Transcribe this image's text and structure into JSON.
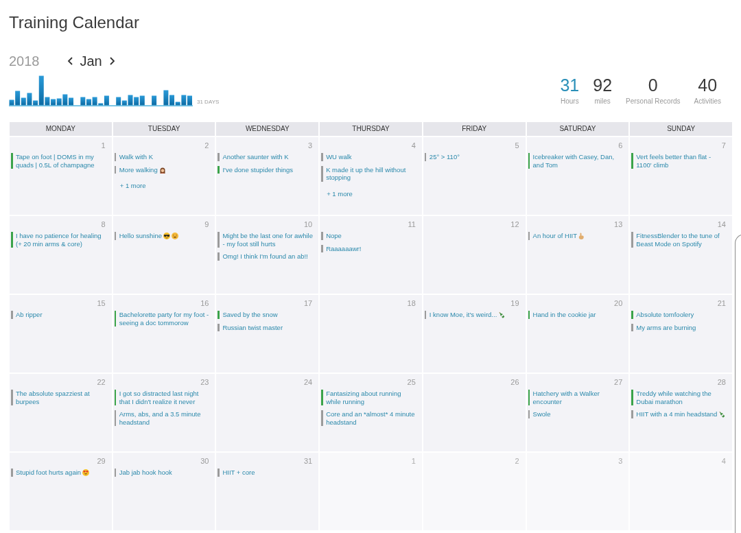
{
  "title": "Training Calendar",
  "nav": {
    "year": "2018",
    "month": "Jan"
  },
  "sparkline": {
    "label": "31 DAYS"
  },
  "stats": [
    {
      "value": "31",
      "label": "Hours",
      "selected": true
    },
    {
      "value": "92",
      "label": "miles",
      "selected": false
    },
    {
      "value": "0",
      "label": "Personal Records",
      "selected": false
    },
    {
      "value": "40",
      "label": "Activities",
      "selected": false
    }
  ],
  "calendar": {
    "weekdays": [
      "MONDAY",
      "TUESDAY",
      "WEDNESDAY",
      "THURSDAY",
      "FRIDAY",
      "SATURDAY",
      "SUNDAY"
    ],
    "weeks": [
      {
        "days": [
          {
            "day": "1",
            "other_month": false,
            "events": [
              {
                "text": "Tape on foot | DOMS in my quads | 0.5L of champagne",
                "color": "#3ba34a"
              }
            ]
          },
          {
            "day": "2",
            "other_month": false,
            "events": [
              {
                "text": "Walk with K",
                "color": "#9b9b9b"
              },
              {
                "text": "More walking",
                "color": "#9b9b9b",
                "emoji": [
                  {
                    "kind": "person"
                  }
                ]
              }
            ],
            "more": "+ 1 more"
          },
          {
            "day": "3",
            "other_month": false,
            "events": [
              {
                "text": "Another saunter with K",
                "color": "#9b9b9b"
              },
              {
                "text": "I've done stupider things",
                "color": "#3ba34a"
              }
            ]
          },
          {
            "day": "4",
            "other_month": false,
            "events": [
              {
                "text": "WU walk",
                "color": "#9b9b9b"
              },
              {
                "text": "K made it up the hill without stopping",
                "color": "#9b9b9b"
              }
            ],
            "more": "+ 1 more"
          },
          {
            "day": "5",
            "other_month": false,
            "events": [
              {
                "text": "25° > 110°",
                "color": "#9b9b9b"
              }
            ]
          },
          {
            "day": "6",
            "other_month": false,
            "events": [
              {
                "text": "Icebreaker with Casey, Dan, and Tom",
                "color": "#3ba34a"
              }
            ]
          },
          {
            "day": "7",
            "other_month": false,
            "events": [
              {
                "text": "Vert feels better than flat - 1100' climb",
                "color": "#3ba34a"
              }
            ]
          }
        ]
      },
      {
        "days": [
          {
            "day": "8",
            "other_month": false,
            "events": [
              {
                "text": "I have no patience for healing (+ 20 min arms & core)",
                "color": "#3ba34a"
              }
            ]
          },
          {
            "day": "9",
            "other_month": false,
            "events": [
              {
                "text": "Hello sunshine",
                "color": "#9b9b9b",
                "emoji": [
                  {
                    "kind": "sunglasses-face"
                  },
                  {
                    "kind": "smiling-face"
                  }
                ]
              }
            ]
          },
          {
            "day": "10",
            "other_month": false,
            "events": [
              {
                "text": "Might be the last one for awhile - my foot still hurts",
                "color": "#9b9b9b"
              },
              {
                "text": "Omg! I think I'm found an ab!!",
                "color": "#9b9b9b"
              }
            ]
          },
          {
            "day": "11",
            "other_month": false,
            "events": [
              {
                "text": "Nope",
                "color": "#9b9b9b"
              },
              {
                "text": "Raaaaaawr!",
                "color": "#9b9b9b"
              }
            ]
          },
          {
            "day": "12",
            "other_month": false
          },
          {
            "day": "13",
            "other_month": false,
            "events": [
              {
                "text": "An hour of HIIT",
                "color": "#9b9b9b",
                "emoji": [
                  {
                    "kind": "hand"
                  }
                ]
              }
            ]
          },
          {
            "day": "14",
            "other_month": false,
            "events": [
              {
                "text": "FitnessBlender to the tune of Beast Mode on Spotify",
                "color": "#9b9b9b"
              }
            ]
          }
        ]
      },
      {
        "days": [
          {
            "day": "15",
            "other_month": false,
            "events": [
              {
                "text": "Ab ripper",
                "color": "#9b9b9b"
              }
            ]
          },
          {
            "day": "16",
            "other_month": false,
            "events": [
              {
                "text": "Bachelorette party for my foot - seeing a doc tommorow",
                "color": "#3ba34a"
              }
            ]
          },
          {
            "day": "17",
            "other_month": false,
            "events": [
              {
                "text": "Saved by the snow",
                "color": "#3ba34a"
              },
              {
                "text": "Russian twist master",
                "color": "#9b9b9b"
              }
            ]
          },
          {
            "day": "18",
            "other_month": false
          },
          {
            "day": "19",
            "other_month": false,
            "events": [
              {
                "text": "I know Moe, it's weird...",
                "color": "#9b9b9b",
                "emoji": [
                  {
                    "kind": "bottle"
                  }
                ]
              }
            ]
          },
          {
            "day": "20",
            "other_month": false,
            "events": [
              {
                "text": "Hand in the cookie jar",
                "color": "#3ba34a"
              }
            ]
          },
          {
            "day": "21",
            "other_month": false,
            "events": [
              {
                "text": "Absolute tomfoolery",
                "color": "#3ba34a"
              },
              {
                "text": "My arms are burning",
                "color": "#9b9b9b"
              }
            ]
          }
        ]
      },
      {
        "days": [
          {
            "day": "22",
            "other_month": false,
            "events": [
              {
                "text": "The absolute spazziest at burpees",
                "color": "#9b9b9b"
              }
            ]
          },
          {
            "day": "23",
            "other_month": false,
            "events": [
              {
                "text": "I got so distracted last night that I didn't realize it never",
                "color": "#3ba34a"
              },
              {
                "text": "Arms, abs, and a 3.5 minute headstand",
                "color": "#9b9b9b"
              }
            ]
          },
          {
            "day": "24",
            "other_month": false
          },
          {
            "day": "25",
            "other_month": false,
            "events": [
              {
                "text": "Fantasizing about running while running",
                "color": "#3ba34a"
              },
              {
                "text": "Core and an *almost* 4 minute headstand",
                "color": "#9b9b9b"
              }
            ]
          },
          {
            "day": "26",
            "other_month": false
          },
          {
            "day": "27",
            "other_month": false,
            "events": [
              {
                "text": "Hatchery with a Walker encounter",
                "color": "#3ba34a"
              },
              {
                "text": "Swole",
                "color": "#9b9b9b"
              }
            ]
          },
          {
            "day": "28",
            "other_month": false,
            "events": [
              {
                "text": "Treddy while watching the Dubai marathon",
                "color": "#3ba34a"
              },
              {
                "text": "HIIT with a 4 min headstand",
                "color": "#9b9b9b",
                "emoji": [
                  {
                    "kind": "bottle"
                  }
                ]
              }
            ]
          }
        ]
      },
      {
        "days": [
          {
            "day": "29",
            "other_month": false,
            "events": [
              {
                "text": "Stupid foot hurts again",
                "color": "#9b9b9b",
                "emoji": [
                  {
                    "kind": "heart-eyes-face"
                  }
                ]
              }
            ]
          },
          {
            "day": "30",
            "other_month": false,
            "events": [
              {
                "text": "Jab jab hook hook",
                "color": "#9b9b9b"
              }
            ]
          },
          {
            "day": "31",
            "other_month": false,
            "events": [
              {
                "text": "HIIT + core",
                "color": "#9b9b9b"
              }
            ]
          },
          {
            "day": "1",
            "other_month": true
          },
          {
            "day": "2",
            "other_month": true
          },
          {
            "day": "3",
            "other_month": true
          },
          {
            "day": "4",
            "other_month": true
          }
        ]
      }
    ]
  }
}
